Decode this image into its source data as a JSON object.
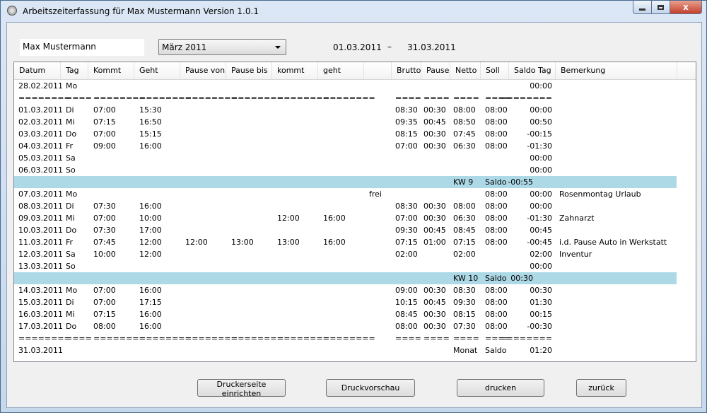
{
  "window": {
    "title": "Arbeitszeiterfassung für Max Mustermann     Version 1.0.1",
    "close_glyph": "x"
  },
  "form": {
    "name": "Max Mustermann",
    "month": "März 2011",
    "date_from": "01.03.2011",
    "date_sep": "–",
    "date_to": "31.03.2011"
  },
  "table": {
    "columns": [
      "Datum",
      "Tag",
      "Kommt",
      "Geht",
      "Pause von",
      "Pause bis",
      "kommt",
      "geht",
      "",
      "Brutto",
      "Pause",
      "Netto",
      "Soll",
      "Saldo Tag",
      "Bemerkung"
    ],
    "rows": [
      {
        "datum": "28.02.2011",
        "tag": "Mo",
        "saldo": "00:00"
      },
      {
        "datum": "========",
        "tag": "====",
        "kommt": "========",
        "geht": "========",
        "pvon": "========",
        "pbis": "========",
        "k2": "========",
        "g2": "========",
        "brutto": "====",
        "pause": "====",
        "netto": "====",
        "soll": "====",
        "saldo": "========"
      },
      {
        "datum": "01.03.2011",
        "tag": "Di",
        "kommt": "07:00",
        "geht": "15:30",
        "brutto": "08:30",
        "pause": "00:30",
        "netto": "08:00",
        "soll": "08:00",
        "saldo": "00:00"
      },
      {
        "datum": "02.03.2011",
        "tag": "Mi",
        "kommt": "07:15",
        "geht": "16:50",
        "brutto": "09:35",
        "pause": "00:45",
        "netto": "08:50",
        "soll": "08:00",
        "saldo": "00:50"
      },
      {
        "datum": "03.03.2011",
        "tag": "Do",
        "kommt": "07:00",
        "geht": "15:15",
        "brutto": "08:15",
        "pause": "00:30",
        "netto": "07:45",
        "soll": "08:00",
        "saldo": "-00:15"
      },
      {
        "datum": "04.03.2011",
        "tag": "Fr",
        "kommt": "09:00",
        "geht": "16:00",
        "brutto": "07:00",
        "pause": "00:30",
        "netto": "06:30",
        "soll": "08:00",
        "saldo": "-01:30"
      },
      {
        "datum": "05.03.2011",
        "tag": "Sa",
        "saldo": "00:00"
      },
      {
        "datum": "06.03.2011",
        "tag": "So",
        "saldo": "00:00"
      },
      {
        "kw": true,
        "netto": "KW 9",
        "soll": "Saldo",
        "saldo": "-00:55"
      },
      {
        "datum": "07.03.2011",
        "tag": "Mo",
        "extra": "frei",
        "soll": "08:00",
        "saldo": "00:00",
        "bem": "Rosenmontag Urlaub"
      },
      {
        "datum": "08.03.2011",
        "tag": "Di",
        "kommt": "07:30",
        "geht": "16:00",
        "brutto": "08:30",
        "pause": "00:30",
        "netto": "08:00",
        "soll": "08:00",
        "saldo": "00:00"
      },
      {
        "datum": "09.03.2011",
        "tag": "Mi",
        "kommt": "07:00",
        "geht": "10:00",
        "k2": "12:00",
        "g2": "16:00",
        "brutto": "07:00",
        "pause": "00:30",
        "netto": "06:30",
        "soll": "08:00",
        "saldo": "-01:30",
        "bem": "Zahnarzt"
      },
      {
        "datum": "10.03.2011",
        "tag": "Do",
        "kommt": "07:30",
        "geht": "17:00",
        "brutto": "09:30",
        "pause": "00:45",
        "netto": "08:45",
        "soll": "08:00",
        "saldo": "00:45"
      },
      {
        "datum": "11.03.2011",
        "tag": "Fr",
        "kommt": "07:45",
        "geht": "12:00",
        "pvon": "12:00",
        "pbis": "13:00",
        "k2": "13:00",
        "g2": "16:00",
        "brutto": "07:15",
        "pause": "01:00",
        "netto": "07:15",
        "soll": "08:00",
        "saldo": "-00:45",
        "bem": "i.d. Pause Auto in Werkstatt"
      },
      {
        "datum": "12.03.2011",
        "tag": "Sa",
        "kommt": "10:00",
        "geht": "12:00",
        "brutto": "02:00",
        "netto": "02:00",
        "saldo": "02:00",
        "bem": "Inventur"
      },
      {
        "datum": "13.03.2011",
        "tag": "So",
        "saldo": "00:00"
      },
      {
        "kw": true,
        "netto": "KW 10",
        "soll": "Saldo",
        "saldo": "00:30"
      },
      {
        "datum": "14.03.2011",
        "tag": "Mo",
        "kommt": "07:00",
        "geht": "16:00",
        "brutto": "09:00",
        "pause": "00:30",
        "netto": "08:30",
        "soll": "08:00",
        "saldo": "00:30"
      },
      {
        "datum": "15.03.2011",
        "tag": "Di",
        "kommt": "07:00",
        "geht": "17:15",
        "brutto": "10:15",
        "pause": "00:45",
        "netto": "09:30",
        "soll": "08:00",
        "saldo": "01:30"
      },
      {
        "datum": "16.03.2011",
        "tag": "Mi",
        "kommt": "07:15",
        "geht": "16:00",
        "brutto": "08:45",
        "pause": "00:30",
        "netto": "08:15",
        "soll": "08:00",
        "saldo": "00:15"
      },
      {
        "datum": "17.03.2011",
        "tag": "Do",
        "kommt": "08:00",
        "geht": "16:00",
        "brutto": "08:00",
        "pause": "00:30",
        "netto": "07:30",
        "soll": "08:00",
        "saldo": "-00:30"
      },
      {
        "datum": "========",
        "tag": "====",
        "kommt": "========",
        "geht": "========",
        "pvon": "========",
        "pbis": "========",
        "k2": "========",
        "g2": "========",
        "brutto": "====",
        "pause": "====",
        "netto": "====",
        "soll": "====",
        "saldo": "========"
      },
      {
        "datum": "31.03.2011",
        "netto": "Monat",
        "soll": "Saldo",
        "saldo": "01:20"
      }
    ]
  },
  "buttons": {
    "page_setup": "Druckerseite einrichten",
    "preview": "Druckvorschau",
    "print": "drucken",
    "back": "zurück"
  }
}
